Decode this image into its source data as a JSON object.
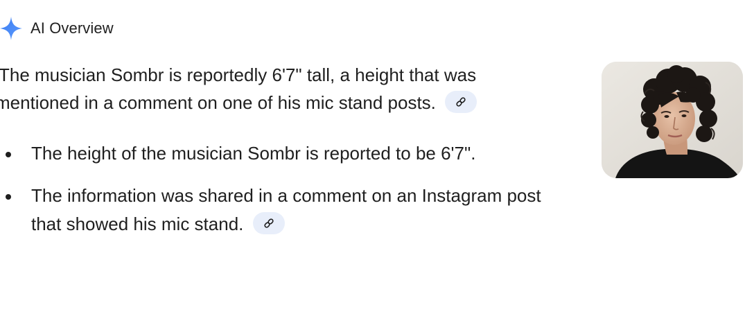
{
  "header": {
    "title": "AI Overview",
    "icon": "sparkle-icon",
    "icon_color": "#4285f4"
  },
  "summary": {
    "line1": "The musician Sombr is reportedly 6'7\" tall, a height that was",
    "line2": "mentioned in a comment on one of his mic stand posts.",
    "link_icon": "link-icon"
  },
  "bullets": [
    {
      "text": "The height of the musician Sombr is reported to be 6'7\"."
    },
    {
      "line1": "The information was shared in a comment on an Instagram post",
      "line2": "that showed his mic stand.",
      "link_icon": "link-icon"
    }
  ],
  "image": {
    "alt": "Photo of Sombr"
  },
  "colors": {
    "text": "#1f1f1f",
    "chip_background": "#e8eefa",
    "accent": "#4285f4"
  }
}
